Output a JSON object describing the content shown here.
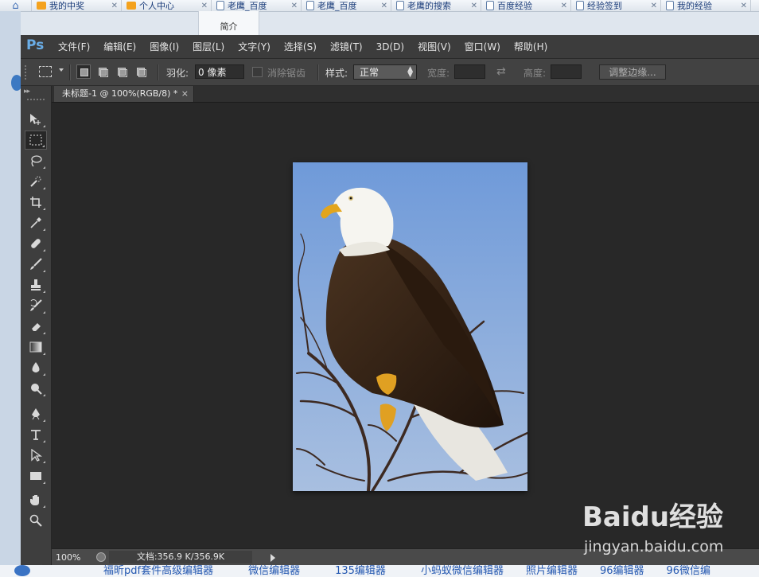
{
  "browser": {
    "tabs": [
      {
        "label": "我的中奖"
      },
      {
        "label": "个人中心"
      },
      {
        "label": "老鹰_百度"
      },
      {
        "label": "老鹰_百度"
      },
      {
        "label": "老鹰的搜索"
      },
      {
        "label": "百度经验"
      },
      {
        "label": "经验签到"
      },
      {
        "label": "我的经验"
      }
    ],
    "intro_tab": "简介",
    "bottom_links": [
      "福昕pdf套件高级编辑器",
      "微信编辑器",
      "135编辑器",
      "小蚂蚁微信编辑器",
      "照片编辑器",
      "96编辑器",
      "96微信编"
    ]
  },
  "ps": {
    "logo": "Ps",
    "menu": [
      "文件(F)",
      "编辑(E)",
      "图像(I)",
      "图层(L)",
      "文字(Y)",
      "选择(S)",
      "滤镜(T)",
      "3D(D)",
      "视图(V)",
      "窗口(W)",
      "帮助(H)"
    ],
    "options": {
      "feather_label": "羽化:",
      "feather_value": "0 像素",
      "antialias_label": "消除锯齿",
      "style_label": "样式:",
      "style_value": "正常",
      "width_label": "宽度:",
      "height_label": "高度:",
      "refine_button": "调整边缘..."
    },
    "document": {
      "tab_title": "未标题-1 @ 100%(RGB/8) *",
      "close": "×"
    },
    "status": {
      "zoom": "100%",
      "doc_info": "文档:356.9 K/356.9K"
    },
    "tools": [
      "move-tool",
      "rectangular-marquee-tool",
      "lasso-tool",
      "quick-selection-tool",
      "crop-tool",
      "eyedropper-tool",
      "spot-healing-tool",
      "brush-tool",
      "clone-stamp-tool",
      "history-brush-tool",
      "eraser-tool",
      "gradient-tool",
      "blur-tool",
      "dodge-tool",
      "pen-tool",
      "type-tool",
      "path-selection-tool",
      "rectangle-tool",
      "hand-tool",
      "zoom-tool"
    ],
    "colors": {
      "foreground": "#000000",
      "background": "#ffffff",
      "accent": "#6aaee8"
    }
  },
  "watermark": {
    "logo": "Baidu经验",
    "url": "jingyan.baidu.com"
  }
}
